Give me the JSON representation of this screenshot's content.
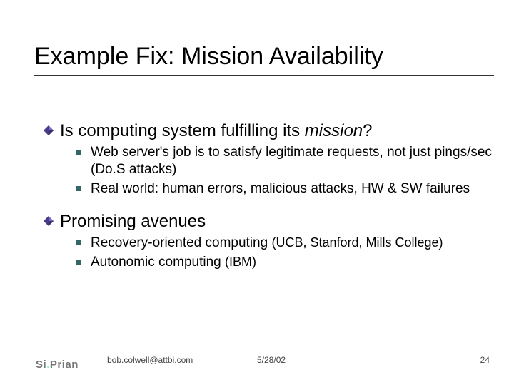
{
  "title": "Example Fix: Mission Availability",
  "points": {
    "p1": {
      "prefix": "Is computing system fulfilling its ",
      "em": "mission",
      "suffix": "?",
      "sub": [
        "Web server's job is to satisfy legitimate requests, not just pings/sec (Do.S attacks)",
        "Real world: human errors, malicious attacks, HW & SW failures"
      ]
    },
    "p2": {
      "text": "Promising avenues",
      "sub1": {
        "main": "Recovery-oriented computing ",
        "paren": "(UCB, Stanford, Mills College)"
      },
      "sub2": {
        "main": "Autonomic computing ",
        "paren": "(IBM)"
      }
    }
  },
  "footer": {
    "email": "bob.colwell@attbi.com",
    "date": "5/28/02",
    "page": "24"
  },
  "logo": {
    "a": "Si",
    "b": "P",
    "c": "rian"
  }
}
